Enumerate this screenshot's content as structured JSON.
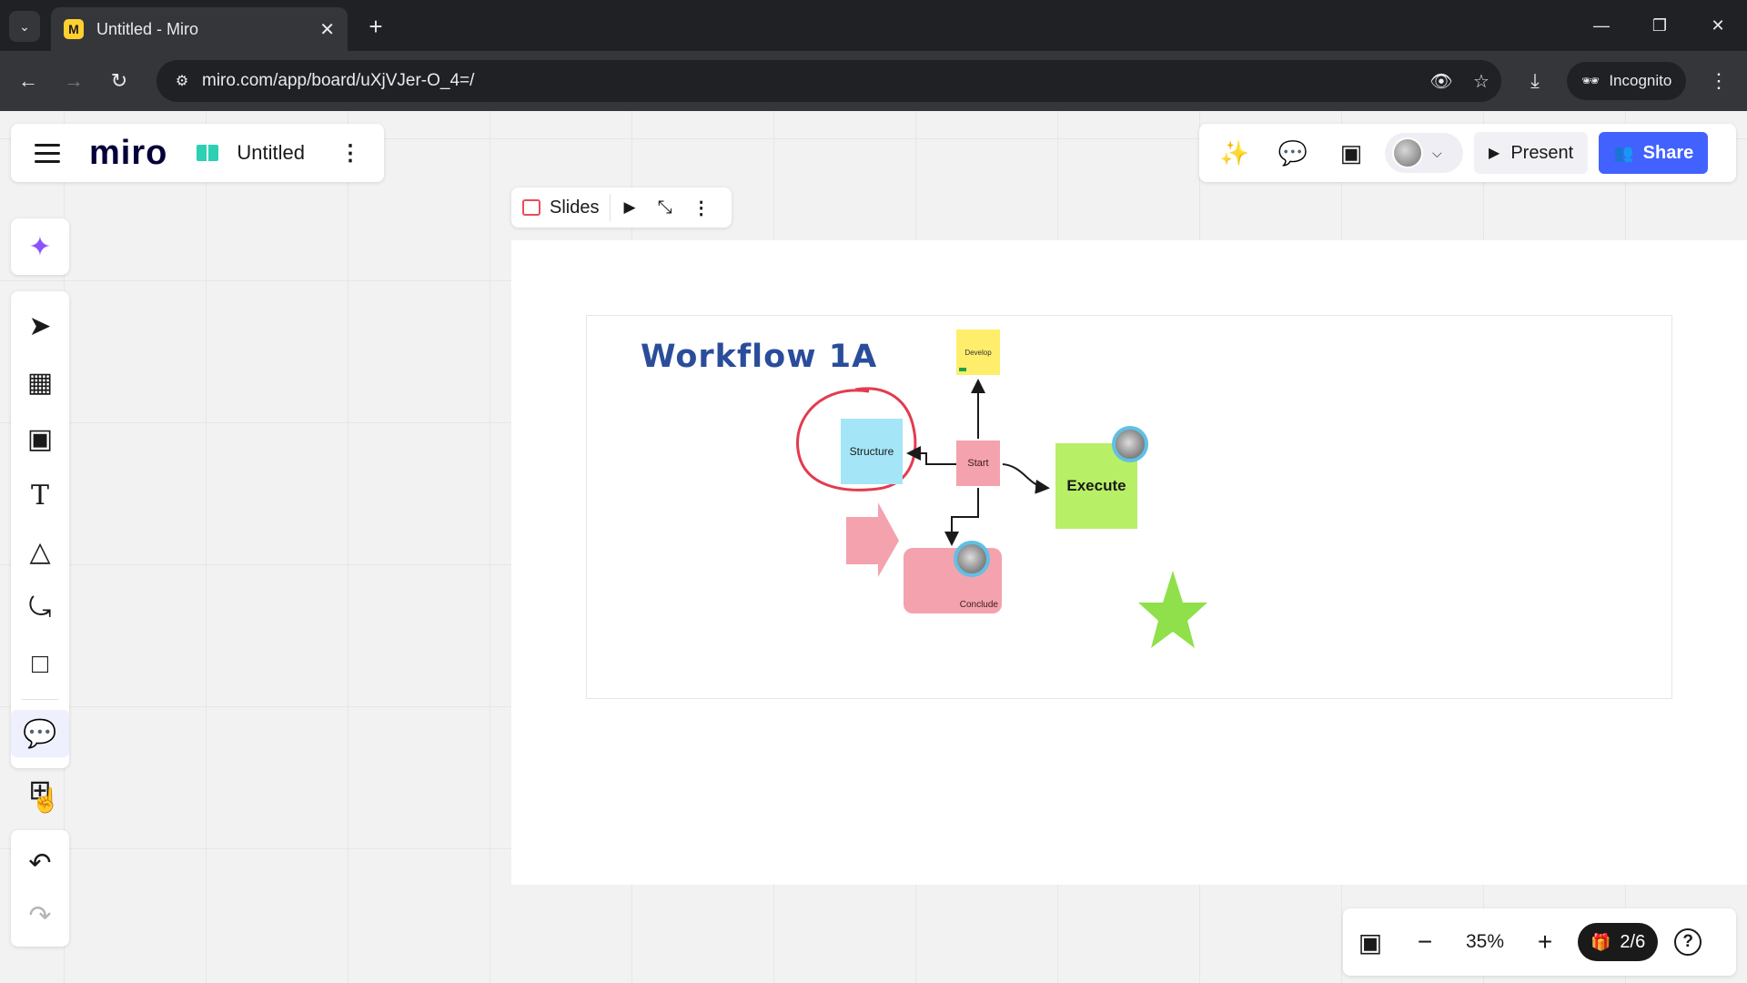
{
  "browser": {
    "tab_title": "Untitled - Miro",
    "favicon_letter": "M",
    "url": "miro.com/app/board/uXjVJer-O_4=/",
    "incognito_label": "Incognito"
  },
  "app": {
    "logo": "miro",
    "board_name": "Untitled",
    "present_label": "Present",
    "share_label": "Share"
  },
  "slides_bar": {
    "label": "Slides"
  },
  "canvas": {
    "frame_title": "Workflow 1A",
    "notes": {
      "develop": "Develop",
      "structure": "Structure",
      "start": "Start",
      "execute": "Execute",
      "conclude": "Conclude"
    }
  },
  "bottom_bar": {
    "zoom": "35%",
    "page": "2/6"
  },
  "colors": {
    "accent": "#4262ff",
    "ai": "#8a53ff",
    "sticky_yellow": "#ffee6b",
    "sticky_blue": "#a4e6f7",
    "sticky_pink": "#f4a2ad",
    "sticky_green": "#b7ef66",
    "star_green": "#8fe04a",
    "circle_red": "#e33b4f"
  }
}
